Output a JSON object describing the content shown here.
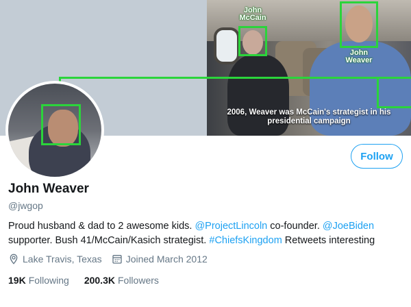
{
  "banner": {
    "caption": "2006, Weaver was McCain's strategist in his presidential campaign",
    "label_left": "John McCain",
    "label_right": "John Weaver"
  },
  "profile": {
    "name": "John Weaver",
    "handle": "@jwgop",
    "follow_label": "Follow",
    "bio": {
      "part1": "Proud husband & dad to 2 awesome kids. ",
      "mention1": "@ProjectLincoln",
      "part2": " co-founder. ",
      "mention2": "@JoeBiden",
      "part3": " supporter. Bush 41/McCain/Kasich strategist. ",
      "hashtag": "#ChiefsKingdom",
      "part4": " Retweets interesting"
    },
    "location": "Lake Travis, Texas",
    "joined": "Joined March 2012",
    "following_count": "19K",
    "following_label": "Following",
    "followers_count": "200.3K",
    "followers_label": "Followers"
  },
  "colors": {
    "accent": "#1da1f2",
    "face_box": "#2bd43b",
    "muted": "#657786"
  },
  "icons": [
    "location-pin-icon",
    "calendar-icon"
  ]
}
